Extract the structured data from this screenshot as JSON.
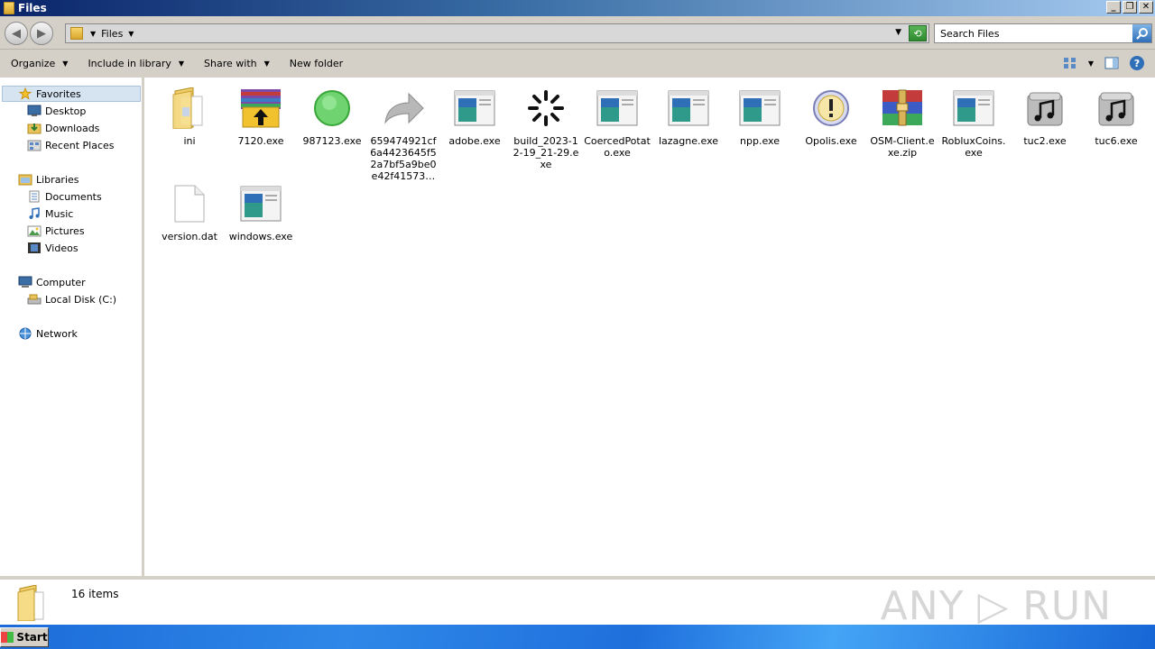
{
  "window": {
    "title": "Files",
    "minimize": "_",
    "restore": "❐",
    "close": "✕"
  },
  "address": {
    "crumb": "Files",
    "search_placeholder": "Search Files"
  },
  "toolbar": {
    "organize": "Organize",
    "include_in_library": "Include in library",
    "share_with": "Share with",
    "new_folder": "New folder"
  },
  "nav": {
    "favorites": "Favorites",
    "desktop": "Desktop",
    "downloads": "Downloads",
    "recent_places": "Recent Places",
    "libraries": "Libraries",
    "documents": "Documents",
    "music": "Music",
    "pictures": "Pictures",
    "videos": "Videos",
    "computer": "Computer",
    "local_disk": "Local Disk (C:)",
    "network": "Network"
  },
  "files": [
    {
      "name": "ini",
      "icon": "folder-icon"
    },
    {
      "name": "7120.exe",
      "icon": "winrar-sfx-icon"
    },
    {
      "name": "987123.exe",
      "icon": "green-circle-icon"
    },
    {
      "name": "659474921cf6a4423645f52a7bf5a9be0e42f41573…",
      "icon": "shortcut-arrow-icon"
    },
    {
      "name": "adobe.exe",
      "icon": "exe-window-icon"
    },
    {
      "name": "build_2023-12-19_21-29.exe",
      "icon": "loading-spinner-icon"
    },
    {
      "name": "CoercedPotato.exe",
      "icon": "exe-window-icon"
    },
    {
      "name": "lazagne.exe",
      "icon": "exe-window-icon"
    },
    {
      "name": "npp.exe",
      "icon": "exe-window-icon"
    },
    {
      "name": "Opolis.exe",
      "icon": "warning-circle-icon"
    },
    {
      "name": "OSM-Client.exe.zip",
      "icon": "winrar-archive-icon"
    },
    {
      "name": "RobluxCoins.exe",
      "icon": "exe-window-icon"
    },
    {
      "name": "tuc2.exe",
      "icon": "music-drive-icon"
    },
    {
      "name": "tuc6.exe",
      "icon": "music-drive-icon"
    },
    {
      "name": "version.dat",
      "icon": "blank-file-icon"
    },
    {
      "name": "windows.exe",
      "icon": "exe-window-icon"
    }
  ],
  "details": {
    "count": "16 items",
    "watermark": "ANY ▷ RUN"
  },
  "taskbar": {
    "start": "Start"
  }
}
